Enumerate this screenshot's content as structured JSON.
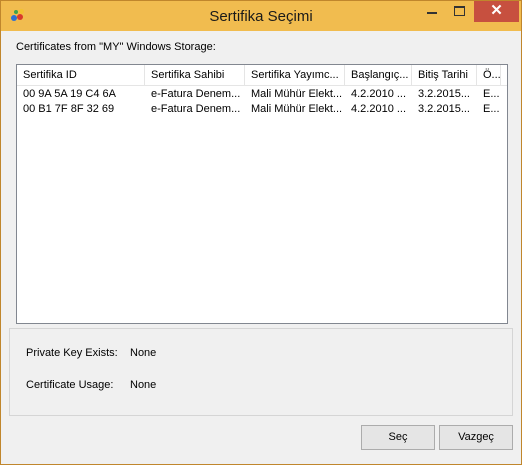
{
  "window": {
    "title": "Sertifika Seçimi",
    "accent_color": "#f1bc4f",
    "close_color": "#c7503f",
    "icon": "app-icon",
    "controls": {
      "minimize": "minimize-icon",
      "maximize": "maximize-icon",
      "close": "✕"
    }
  },
  "storage_label": "Certificates from \"MY\" Windows Storage:",
  "table": {
    "columns": [
      "Sertifika ID",
      "Sertifika Sahibi",
      "Sertifika Yayımc...",
      "Başlangıç...",
      "Bitiş Tarihi",
      "Ö..."
    ],
    "rows": [
      [
        "00 9A 5A 19 C4 6A",
        "e-Fatura Denem...",
        "Mali Mühür Elekt...",
        "4.2.2010 ...",
        "3.2.2015...",
        "E..."
      ],
      [
        "00 B1 7F 8F 32 69",
        "e-Fatura Denem...",
        "Mali Mühür Elekt...",
        "4.2.2010 ...",
        "3.2.2015...",
        "E..."
      ]
    ]
  },
  "info": {
    "private_key_label": "Private Key Exists:",
    "private_key_value": "None",
    "usage_label": "Certificate Usage:",
    "usage_value": "None"
  },
  "buttons": {
    "select": "Seç",
    "cancel": "Vazgeç"
  }
}
